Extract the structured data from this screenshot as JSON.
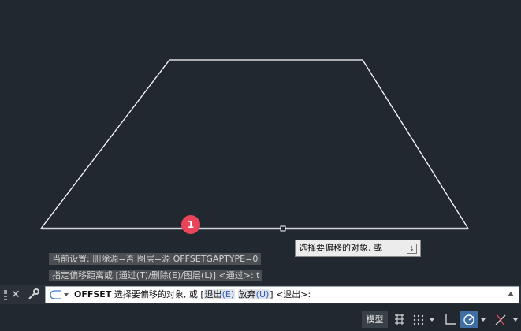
{
  "history": {
    "line1": "当前设置: 删除源=否  图层=源  OFFSETGAPTYPE=0",
    "line2": "指定偏移距离或 [通过(T)/删除(E)/图层(L)] <通过>:  t"
  },
  "marker": {
    "label": "1"
  },
  "tooltip": {
    "text": "选择要偏移的对象, 或"
  },
  "command_line": {
    "command": "OFFSET",
    "prompt": "选择要偏移的对象, 或 [",
    "option1_name": "退出",
    "option1_key": "(E)",
    "option2_name": "放弃",
    "option2_key": "(U)",
    "suffix": "] <退出>:"
  },
  "status_bar": {
    "model_label": "模型"
  },
  "colors": {
    "background": "#212830",
    "geometry": "#ffffff",
    "marker": "#e8455a",
    "active_button": "#3f6fa3"
  },
  "icons": [
    "close-icon",
    "wrench-icon",
    "prompt-icon",
    "grid-icon",
    "snap-icon",
    "ortho-icon",
    "polar-icon",
    "osnap-icon"
  ]
}
